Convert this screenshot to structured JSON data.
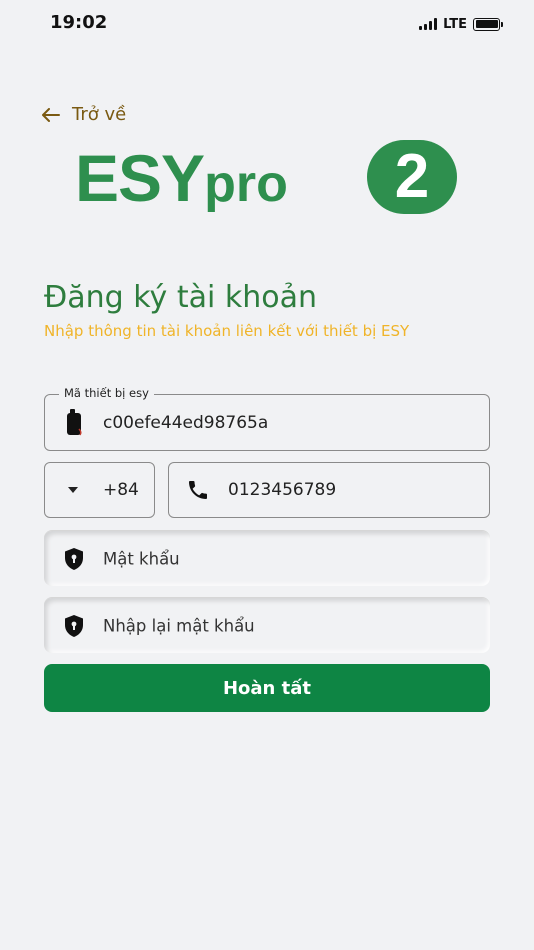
{
  "status_bar": {
    "time": "19:02",
    "network": "LTE"
  },
  "back": {
    "label": "Trở về",
    "icon": "arrow-left-icon"
  },
  "logo": {
    "text_main": "ESY",
    "text_small": "pro",
    "badge": "2",
    "color": "#2e8f4e"
  },
  "title": "Đăng ký tài khoản",
  "subtitle": "Nhập thông tin tài khoản liên kết với thiết bị ESY",
  "device_field": {
    "label": "Mã thiết bị esy",
    "value": "c00efe44ed98765a",
    "icon": "device-icon"
  },
  "country_code": {
    "value": "+84",
    "icon": "caret-down-icon"
  },
  "phone_field": {
    "value": "0123456789",
    "icon": "phone-icon"
  },
  "password_field": {
    "placeholder": "Mật khẩu",
    "icon": "shield-lock-icon"
  },
  "confirm_password_field": {
    "placeholder": "Nhập lại mật khẩu",
    "icon": "shield-lock-icon"
  },
  "submit": {
    "label": "Hoàn tất"
  },
  "colors": {
    "brand_green": "#2e8f4e",
    "button_green": "#0e8544",
    "subtitle_yellow": "#f0b429",
    "back_brown": "#7a5a12"
  }
}
